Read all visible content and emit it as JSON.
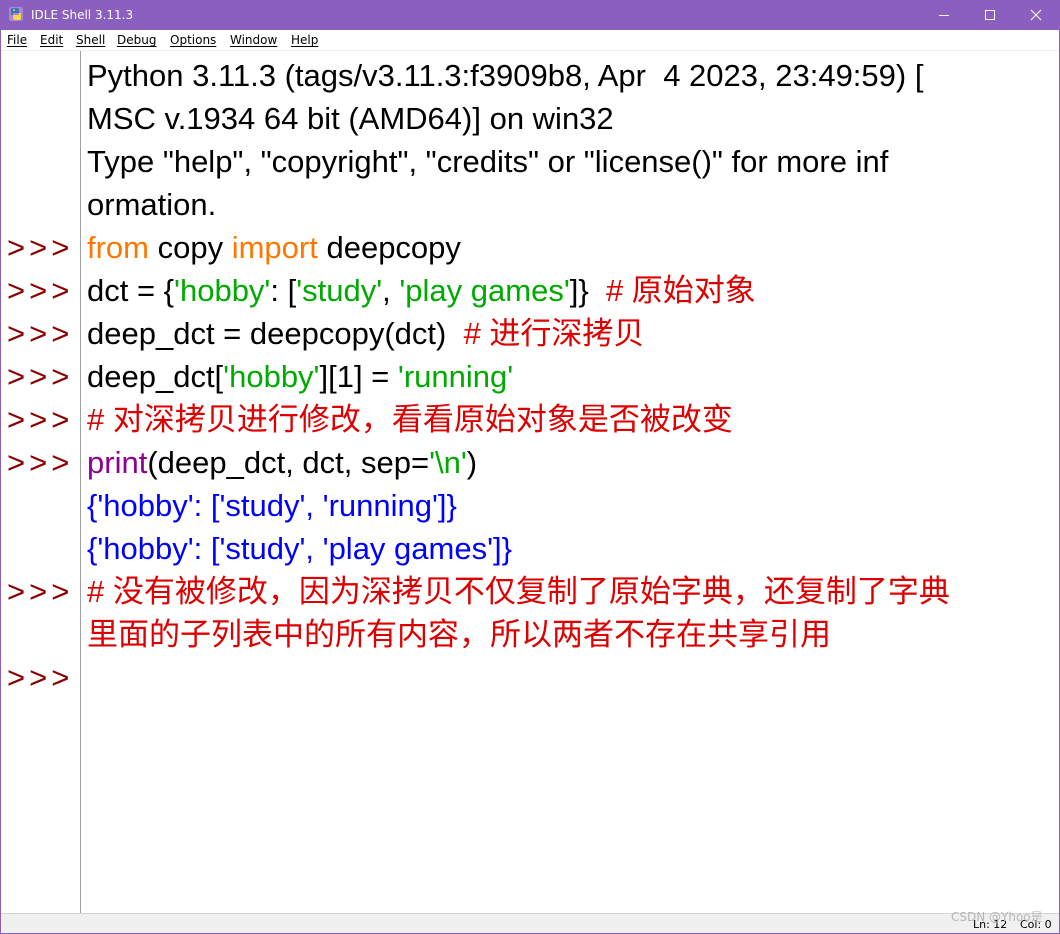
{
  "window": {
    "title": "IDLE Shell 3.11.3",
    "buttons": {
      "minimize": "minimize",
      "maximize": "maximize",
      "close": "close"
    }
  },
  "menu": {
    "items": [
      "File",
      "Edit",
      "Shell",
      "Debug",
      "Options",
      "Window",
      "Help"
    ]
  },
  "prompt_symbol": ">>>",
  "shell": {
    "banner": [
      "Python 3.11.3 (tags/v3.11.3:f3909b8, Apr  4 2023, 23:49:59) [",
      "MSC v.1934 64 bit (AMD64)] on win32",
      "Type \"help\", \"copyright\", \"credits\" or \"license()\" for more inf",
      "ormation."
    ],
    "cmd1": {
      "kw_from": "from",
      "mid": " copy ",
      "kw_import": "import",
      "rest": " deepcopy"
    },
    "cmd2": {
      "a": "dct = {",
      "s1": "'hobby'",
      "b": ": [",
      "s2": "'study'",
      "c": ", ",
      "s3": "'play games'",
      "d": "]}  ",
      "comment": "# 原始对象"
    },
    "cmd3": {
      "code": "deep_dct = deepcopy(dct)  ",
      "comment": "# 进行深拷贝"
    },
    "cmd4": {
      "a": "deep_dct[",
      "s1": "'hobby'",
      "b": "][1] = ",
      "s2": "'running'"
    },
    "cmd5": {
      "comment": "# 对深拷贝进行修改，看看原始对象是否被改变"
    },
    "cmd6": {
      "builtin": "print",
      "a": "(deep_dct, dct, sep=",
      "s": "'\\n'",
      "b": ")"
    },
    "output": [
      "{'hobby': ['study', 'running']}",
      "{'hobby': ['study', 'play games']}"
    ],
    "cmd7": {
      "comment_line1": "# 没有被修改，因为深拷贝不仅复制了原始字典，还复制了字典",
      "comment_line2": "里面的子列表中的所有内容，所以两者不存在共享引用"
    }
  },
  "status": {
    "line": "Ln: 12",
    "col": "Col: 0"
  },
  "watermark": "CSDN @Yhoo是",
  "colors": {
    "titlebar": "#8a5fbf",
    "prompt": "#8b0000",
    "keyword": "#ff7700",
    "string": "#00aa00",
    "comment": "#dd0000",
    "builtin": "#900090",
    "output": "#0000ff"
  }
}
